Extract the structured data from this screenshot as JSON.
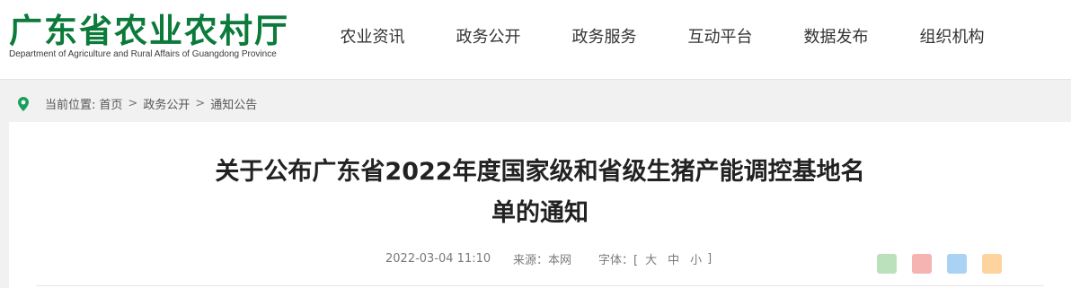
{
  "header": {
    "logo_cn": "广东省农业农村厅",
    "logo_en": "Department of Agriculture and Rural Affairs of Guangdong Province",
    "nav": [
      {
        "label": "农业资讯"
      },
      {
        "label": "政务公开"
      },
      {
        "label": "政务服务"
      },
      {
        "label": "互动平台"
      },
      {
        "label": "数据发布"
      },
      {
        "label": "组织机构"
      }
    ]
  },
  "breadcrumb": {
    "prefix": "当前位置:",
    "items": [
      {
        "label": "首页"
      },
      {
        "label": "政务公开"
      },
      {
        "label": "通知公告"
      }
    ],
    "separator": ">"
  },
  "article": {
    "title_line1": "关于公布广东省2022年度国家级和省级生猪产能调控基地名",
    "title_line2": "单的通知",
    "date": "2022-03-04 11:10",
    "source": "来源：本网",
    "font_label": "字体：[",
    "font_sizes": [
      "大",
      "中",
      "小"
    ],
    "font_close": "]"
  },
  "share": {
    "icons": [
      {
        "name": "wechat-share-icon",
        "color": "#4caf50"
      },
      {
        "name": "weibo-share-icon",
        "color": "#e53935"
      },
      {
        "name": "qq-share-icon",
        "color": "#1e88e5"
      },
      {
        "name": "qzone-share-icon",
        "color": "#fb8c00"
      }
    ]
  },
  "colors": {
    "brand_green": "#0b7a3a",
    "pin_green": "#19a05a",
    "page_bg": "#f1f1f1"
  }
}
